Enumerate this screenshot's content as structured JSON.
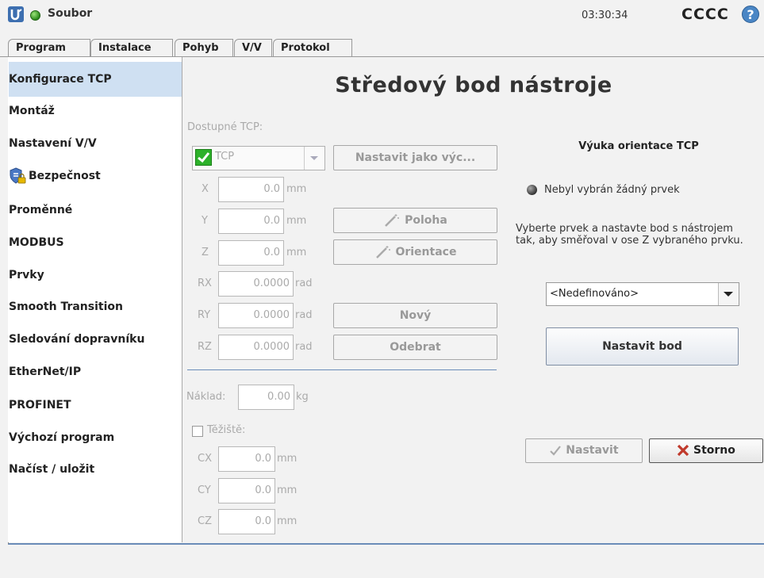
{
  "topbar": {
    "file_label": "Soubor",
    "clock": "03:30:34",
    "robot_name": "CCCC",
    "help_glyph": "?",
    "status_color": "#2c8a1c"
  },
  "tabs": [
    "Program",
    "Instalace",
    "Pohyb",
    "V/V",
    "Protokol"
  ],
  "active_tab": "Instalace",
  "sidebar": {
    "items": [
      "Konfigurace TCP",
      "Montáž",
      "Nastavení V/V",
      "Bezpečnost",
      "Proměnné",
      "MODBUS",
      "Prvky",
      "Smooth Transition",
      "Sledování dopravníku",
      "EtherNet/IP",
      "PROFINET",
      "Výchozí program",
      "Načíst / uložit"
    ],
    "selected": "Konfigurace TCP",
    "selected_color": "#cfe0f2"
  },
  "main": {
    "title": "Středový bod nástroje",
    "available_tcp_label": "Dostupné TCP:",
    "tcp_selected": "TCP",
    "set_default_button": "Nastavit jako výc...",
    "position_button": "Poloha",
    "orientation_button": "Orientace",
    "new_button": "Nový",
    "remove_button": "Odebrat",
    "coords": [
      {
        "label": "X",
        "value": "0.0",
        "unit": "mm"
      },
      {
        "label": "Y",
        "value": "0.0",
        "unit": "mm"
      },
      {
        "label": "Z",
        "value": "0.0",
        "unit": "mm"
      },
      {
        "label": "RX",
        "value": "0.0000",
        "unit": "rad"
      },
      {
        "label": "RY",
        "value": "0.0000",
        "unit": "rad"
      },
      {
        "label": "RZ",
        "value": "0.0000",
        "unit": "rad"
      }
    ],
    "payload_label": "Náklad:",
    "payload_value": "0.00",
    "payload_unit": "kg",
    "cog_label": "Těžiště:",
    "cog": [
      {
        "label": "CX",
        "value": "0.0",
        "unit": "mm"
      },
      {
        "label": "CY",
        "value": "0.0",
        "unit": "mm"
      },
      {
        "label": "CZ",
        "value": "0.0",
        "unit": "mm"
      }
    ]
  },
  "teach": {
    "title": "Výuka orientace TCP",
    "no_feature": "Nebyl vybrán žádný prvek",
    "instructions": "Vyberte prvek a nastavte bod s nástrojem tak, aby směřoval v ose Z vybraného prvku.",
    "feature_select": "<Nedefinováno>",
    "set_point_button": "Nastavit bod",
    "apply_button": "Nastavit",
    "cancel_button": "Storno"
  }
}
